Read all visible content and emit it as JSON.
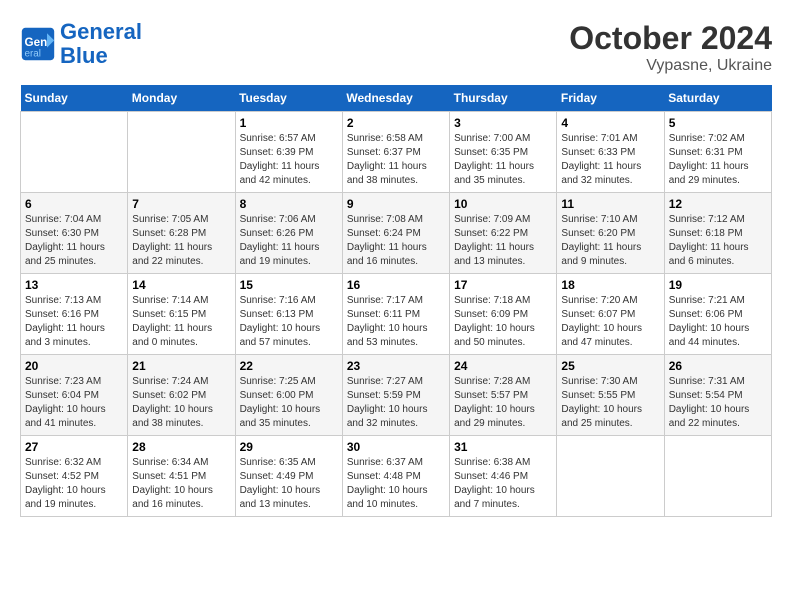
{
  "header": {
    "logo_line1": "General",
    "logo_line2": "Blue",
    "month_year": "October 2024",
    "location": "Vypasne, Ukraine"
  },
  "weekdays": [
    "Sunday",
    "Monday",
    "Tuesday",
    "Wednesday",
    "Thursday",
    "Friday",
    "Saturday"
  ],
  "weeks": [
    [
      {
        "day": "",
        "detail": ""
      },
      {
        "day": "",
        "detail": ""
      },
      {
        "day": "1",
        "detail": "Sunrise: 6:57 AM\nSunset: 6:39 PM\nDaylight: 11 hours and 42 minutes."
      },
      {
        "day": "2",
        "detail": "Sunrise: 6:58 AM\nSunset: 6:37 PM\nDaylight: 11 hours and 38 minutes."
      },
      {
        "day": "3",
        "detail": "Sunrise: 7:00 AM\nSunset: 6:35 PM\nDaylight: 11 hours and 35 minutes."
      },
      {
        "day": "4",
        "detail": "Sunrise: 7:01 AM\nSunset: 6:33 PM\nDaylight: 11 hours and 32 minutes."
      },
      {
        "day": "5",
        "detail": "Sunrise: 7:02 AM\nSunset: 6:31 PM\nDaylight: 11 hours and 29 minutes."
      }
    ],
    [
      {
        "day": "6",
        "detail": "Sunrise: 7:04 AM\nSunset: 6:30 PM\nDaylight: 11 hours and 25 minutes."
      },
      {
        "day": "7",
        "detail": "Sunrise: 7:05 AM\nSunset: 6:28 PM\nDaylight: 11 hours and 22 minutes."
      },
      {
        "day": "8",
        "detail": "Sunrise: 7:06 AM\nSunset: 6:26 PM\nDaylight: 11 hours and 19 minutes."
      },
      {
        "day": "9",
        "detail": "Sunrise: 7:08 AM\nSunset: 6:24 PM\nDaylight: 11 hours and 16 minutes."
      },
      {
        "day": "10",
        "detail": "Sunrise: 7:09 AM\nSunset: 6:22 PM\nDaylight: 11 hours and 13 minutes."
      },
      {
        "day": "11",
        "detail": "Sunrise: 7:10 AM\nSunset: 6:20 PM\nDaylight: 11 hours and 9 minutes."
      },
      {
        "day": "12",
        "detail": "Sunrise: 7:12 AM\nSunset: 6:18 PM\nDaylight: 11 hours and 6 minutes."
      }
    ],
    [
      {
        "day": "13",
        "detail": "Sunrise: 7:13 AM\nSunset: 6:16 PM\nDaylight: 11 hours and 3 minutes."
      },
      {
        "day": "14",
        "detail": "Sunrise: 7:14 AM\nSunset: 6:15 PM\nDaylight: 11 hours and 0 minutes."
      },
      {
        "day": "15",
        "detail": "Sunrise: 7:16 AM\nSunset: 6:13 PM\nDaylight: 10 hours and 57 minutes."
      },
      {
        "day": "16",
        "detail": "Sunrise: 7:17 AM\nSunset: 6:11 PM\nDaylight: 10 hours and 53 minutes."
      },
      {
        "day": "17",
        "detail": "Sunrise: 7:18 AM\nSunset: 6:09 PM\nDaylight: 10 hours and 50 minutes."
      },
      {
        "day": "18",
        "detail": "Sunrise: 7:20 AM\nSunset: 6:07 PM\nDaylight: 10 hours and 47 minutes."
      },
      {
        "day": "19",
        "detail": "Sunrise: 7:21 AM\nSunset: 6:06 PM\nDaylight: 10 hours and 44 minutes."
      }
    ],
    [
      {
        "day": "20",
        "detail": "Sunrise: 7:23 AM\nSunset: 6:04 PM\nDaylight: 10 hours and 41 minutes."
      },
      {
        "day": "21",
        "detail": "Sunrise: 7:24 AM\nSunset: 6:02 PM\nDaylight: 10 hours and 38 minutes."
      },
      {
        "day": "22",
        "detail": "Sunrise: 7:25 AM\nSunset: 6:00 PM\nDaylight: 10 hours and 35 minutes."
      },
      {
        "day": "23",
        "detail": "Sunrise: 7:27 AM\nSunset: 5:59 PM\nDaylight: 10 hours and 32 minutes."
      },
      {
        "day": "24",
        "detail": "Sunrise: 7:28 AM\nSunset: 5:57 PM\nDaylight: 10 hours and 29 minutes."
      },
      {
        "day": "25",
        "detail": "Sunrise: 7:30 AM\nSunset: 5:55 PM\nDaylight: 10 hours and 25 minutes."
      },
      {
        "day": "26",
        "detail": "Sunrise: 7:31 AM\nSunset: 5:54 PM\nDaylight: 10 hours and 22 minutes."
      }
    ],
    [
      {
        "day": "27",
        "detail": "Sunrise: 6:32 AM\nSunset: 4:52 PM\nDaylight: 10 hours and 19 minutes."
      },
      {
        "day": "28",
        "detail": "Sunrise: 6:34 AM\nSunset: 4:51 PM\nDaylight: 10 hours and 16 minutes."
      },
      {
        "day": "29",
        "detail": "Sunrise: 6:35 AM\nSunset: 4:49 PM\nDaylight: 10 hours and 13 minutes."
      },
      {
        "day": "30",
        "detail": "Sunrise: 6:37 AM\nSunset: 4:48 PM\nDaylight: 10 hours and 10 minutes."
      },
      {
        "day": "31",
        "detail": "Sunrise: 6:38 AM\nSunset: 4:46 PM\nDaylight: 10 hours and 7 minutes."
      },
      {
        "day": "",
        "detail": ""
      },
      {
        "day": "",
        "detail": ""
      }
    ]
  ]
}
